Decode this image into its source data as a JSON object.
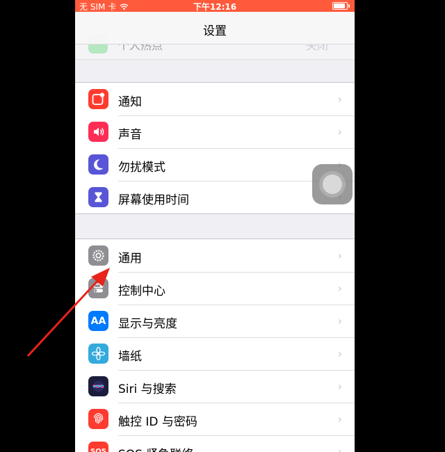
{
  "status_bar": {
    "carrier": "无 SIM 卡",
    "time": "下午12:16",
    "battery_level": 0.9,
    "wifi_icon": "wifi-icon"
  },
  "nav": {
    "title": "设置"
  },
  "partial_row": {
    "label": "个人热点",
    "value": "关闭"
  },
  "groups": [
    {
      "items": [
        {
          "label": "通知",
          "icon": "notifications-icon",
          "color": "#ff3b30"
        },
        {
          "label": "声音",
          "icon": "speaker-icon",
          "color": "#ff2d55"
        },
        {
          "label": "勿扰模式",
          "icon": "moon-icon",
          "color": "#5856d6"
        },
        {
          "label": "屏幕使用时间",
          "icon": "hourglass-icon",
          "color": "#5856d6"
        }
      ]
    },
    {
      "items": [
        {
          "label": "通用",
          "icon": "gear-icon",
          "color": "#8e8e93"
        },
        {
          "label": "控制中心",
          "icon": "toggles-icon",
          "color": "#8e8e93"
        },
        {
          "label": "显示与亮度",
          "icon": "text-size-icon",
          "color": "#007aff"
        },
        {
          "label": "墙纸",
          "icon": "flower-icon",
          "color": "#34aadc"
        },
        {
          "label": "Siri 与搜索",
          "icon": "siri-icon",
          "color": "#1c1c3c"
        },
        {
          "label": "触控 ID 与密码",
          "icon": "fingerprint-icon",
          "color": "#ff3b30"
        },
        {
          "label": "SOS 紧急联络",
          "icon": "sos-icon",
          "color": "#ff3b30"
        }
      ]
    }
  ],
  "icon_text": {
    "display": "AA",
    "sos": "SOS"
  },
  "chevron": "›",
  "colors": {
    "status_bar": "#ff5a3c",
    "background": "#efeff4",
    "arrow": "#e8231a"
  }
}
